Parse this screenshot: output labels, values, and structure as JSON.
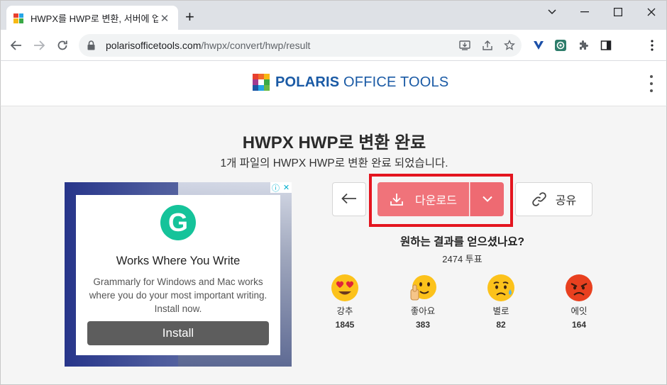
{
  "browser": {
    "tab_title": "HWPX를 HWP로 변환, 서버에 업",
    "url_host": "polarisofficetools.com",
    "url_path": "/hwpx/convert/hwp/result"
  },
  "site": {
    "logo_bold": "POLARIS",
    "logo_rest": " OFFICE TOOLS"
  },
  "page": {
    "title": "HWPX HWP로 변환 완료",
    "subtitle": "1개 파일의 HWPX HWP로 변환 완료 되었습니다."
  },
  "ad": {
    "title": "Works Where You Write",
    "body": "Grammarly for Windows and Mac works where you do your most important writing. Install now.",
    "install_label": "Install"
  },
  "actions": {
    "download_label": "다운로드",
    "share_label": "공유"
  },
  "feedback": {
    "question": "원하는 결과를 얻으셨나요?",
    "votes": "2474 투표",
    "reactions": [
      {
        "label": "강추",
        "count": "1845"
      },
      {
        "label": "좋아요",
        "count": "383"
      },
      {
        "label": "별로",
        "count": "82"
      },
      {
        "label": "에잇",
        "count": "164"
      }
    ]
  },
  "colors": {
    "download": "#f0737a",
    "highlight": "#e4151f",
    "brand": "#1a5aa5"
  }
}
